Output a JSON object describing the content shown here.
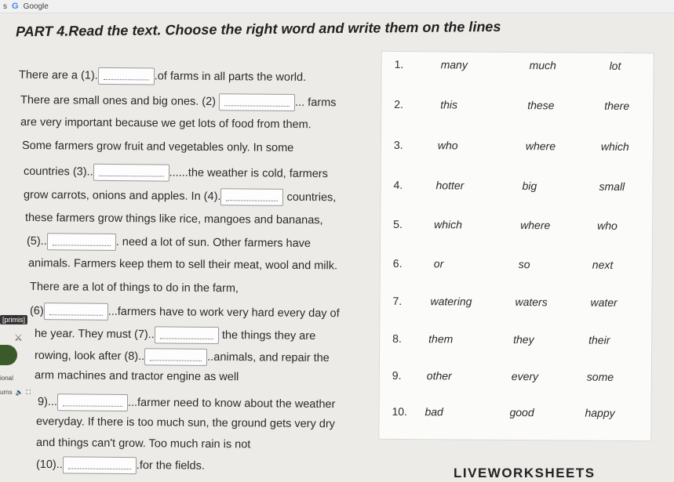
{
  "browser": {
    "tab_fragment": "s",
    "google_label": "Google"
  },
  "title": "PART 4.Read the text. Choose the right word and write them on the lines",
  "passage_lines": [
    {
      "before": "There are a (1).",
      "after": ".of farms in all parts the world."
    },
    {
      "before": "There are small ones and big ones. (2)",
      "after": "... farms"
    },
    {
      "before": "are very important because we get lots of food from them.",
      "after": ""
    },
    {
      "before": "Some farmers grow fruit and vegetables only. In some",
      "after": ""
    },
    {
      "before": "countries (3)..",
      "after": "......the weather is cold, farmers"
    },
    {
      "before": "grow carrots, onions and apples. In (4).",
      "after": "countries,"
    },
    {
      "before": "these farmers grow things like rice, mangoes and bananas,",
      "after": ""
    },
    {
      "before": "(5)..",
      "after": ". need a lot of sun. Other farmers  have"
    },
    {
      "before": "animals. Farmers keep them to sell their meat, wool and milk.",
      "after": ""
    },
    {
      "before": "There are a lot of things to do in the farm,",
      "after": ""
    },
    {
      "before": "(6)",
      "after": "...farmers have to work very hard every day of"
    },
    {
      "before": "he year. They must (7)..",
      "after": " the things they are"
    },
    {
      "before": "rowing, look  after (8)..",
      "after": "..animals, and  repair  the"
    },
    {
      "before": "arm machines and tractor engine as well",
      "after": ""
    },
    {
      "before": "9)...",
      "after": "...farmer need to know about the weather"
    },
    {
      "before": "everyday. If there is too much sun, the ground gets very dry",
      "after": ""
    },
    {
      "before": "and things can't grow. Too much rain is not",
      "after": ""
    },
    {
      "before": "(10)..",
      "after": ".for the fields."
    }
  ],
  "options": [
    {
      "num": "1.",
      "words": [
        "many",
        "much",
        "lot"
      ]
    },
    {
      "num": "2.",
      "words": [
        "this",
        "these",
        "there"
      ]
    },
    {
      "num": "3.",
      "words": [
        "who",
        "where",
        "which"
      ]
    },
    {
      "num": "4.",
      "words": [
        "hotter",
        "big",
        "small"
      ]
    },
    {
      "num": "5.",
      "words": [
        "which",
        "where",
        "who"
      ]
    },
    {
      "num": "6.",
      "words": [
        "or",
        "so",
        "next"
      ]
    },
    {
      "num": "7.",
      "words": [
        "watering",
        "waters",
        "water"
      ]
    },
    {
      "num": "8.",
      "words": [
        "them",
        "they",
        "their"
      ]
    },
    {
      "num": "9.",
      "words": [
        "other",
        "every",
        "some"
      ]
    },
    {
      "num": "10.",
      "words": [
        "bad",
        "good",
        "happy"
      ]
    }
  ],
  "sidebar": {
    "badge": "[primis]",
    "ional": "ional",
    "urns": "urns"
  },
  "brand": "LIVEWORKSHEETS"
}
